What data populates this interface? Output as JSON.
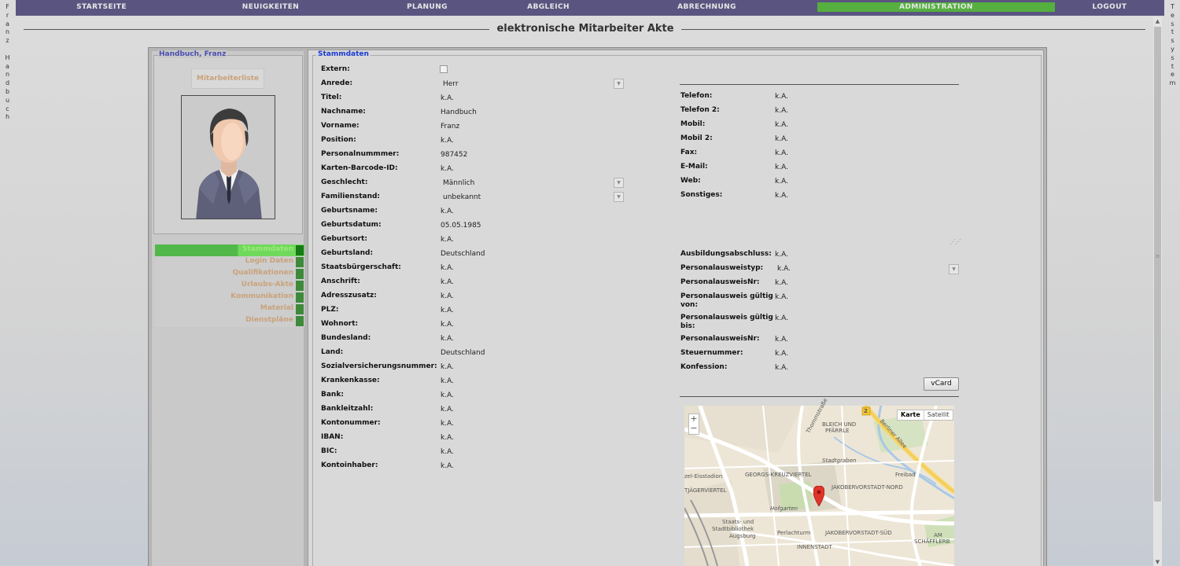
{
  "side_left": {
    "letters": [
      "F",
      "r",
      "a",
      "n",
      "z",
      "",
      "H",
      "a",
      "n",
      "d",
      "b",
      "u",
      "c",
      "h"
    ]
  },
  "side_right": {
    "letters": [
      "T",
      "e",
      "s",
      "t",
      "s",
      "y",
      "s",
      "t",
      "e",
      "m"
    ]
  },
  "nav": {
    "items": [
      {
        "label": "STARTSEITE"
      },
      {
        "label": "NEUIGKEITEN"
      },
      {
        "label": "PLANUNG"
      },
      {
        "label": "ABGLEICH"
      },
      {
        "label": "ABRECHNUNG"
      },
      {
        "label": "ADMINISTRATION"
      },
      {
        "label": "LOGOUT"
      }
    ],
    "active_index": 5
  },
  "window": {
    "title": "elektronische Mitarbeiter Akte"
  },
  "employee": {
    "legend": "Handbuch, Franz",
    "list_button": "Mitarbeiterliste"
  },
  "sidemenu": {
    "items": [
      {
        "label": "Stammdaten"
      },
      {
        "label": "Login Daten"
      },
      {
        "label": "Qualifikationen"
      },
      {
        "label": "Urlaubs-Akte"
      },
      {
        "label": "Kommunikation"
      },
      {
        "label": "Material"
      },
      {
        "label": "Dienstpläne"
      }
    ],
    "active_index": 0
  },
  "stammdaten": {
    "legend": "Stammdaten",
    "left_fields": [
      {
        "label": "Extern:",
        "value": ""
      },
      {
        "label": "Anrede:",
        "value": "Herr"
      },
      {
        "label": "Titel:",
        "value": "k.A."
      },
      {
        "label": "Nachname:",
        "value": "Handbuch"
      },
      {
        "label": "Vorname:",
        "value": "Franz"
      },
      {
        "label": "Position:",
        "value": "k.A."
      },
      {
        "label": "Personalnummmer:",
        "value": "987452"
      },
      {
        "label": "Karten-Barcode-ID:",
        "value": "k.A."
      },
      {
        "label": "Geschlecht:",
        "value": "Männlich"
      },
      {
        "label": "Familienstand:",
        "value": "unbekannt"
      },
      {
        "label": "Geburtsname:",
        "value": "k.A."
      },
      {
        "label": "Geburtsdatum:",
        "value": "05.05.1985"
      },
      {
        "label": "Geburtsort:",
        "value": "k.A."
      },
      {
        "label": "Geburtsland:",
        "value": "Deutschland"
      },
      {
        "label": "Staatsbürgerschaft:",
        "value": "k.A."
      },
      {
        "label": "Anschrift:",
        "value": "k.A."
      },
      {
        "label": "Adresszusatz:",
        "value": "k.A."
      },
      {
        "label": "PLZ:",
        "value": "k.A."
      },
      {
        "label": "Wohnort:",
        "value": "k.A."
      },
      {
        "label": "Bundesland:",
        "value": "k.A."
      },
      {
        "label": "Land:",
        "value": "Deutschland"
      },
      {
        "label": "Sozialversicherungsnummer:",
        "value": "k.A."
      },
      {
        "label": "Krankenkasse:",
        "value": "k.A."
      },
      {
        "label": "Bank:",
        "value": "k.A."
      },
      {
        "label": "Bankleitzahl:",
        "value": "k.A."
      },
      {
        "label": "Kontonummer:",
        "value": "k.A."
      },
      {
        "label": "IBAN:",
        "value": "k.A."
      },
      {
        "label": "BIC:",
        "value": "k.A."
      },
      {
        "label": "Kontoinhaber:",
        "value": "k.A."
      }
    ],
    "contact_fields": [
      {
        "label": "Telefon:",
        "value": "k.A."
      },
      {
        "label": "Telefon 2:",
        "value": "k.A."
      },
      {
        "label": "Mobil:",
        "value": "k.A."
      },
      {
        "label": "Mobil 2:",
        "value": "k.A."
      },
      {
        "label": "Fax:",
        "value": "k.A."
      },
      {
        "label": "E-Mail:",
        "value": "k.A."
      },
      {
        "label": "Web:",
        "value": "k.A."
      },
      {
        "label": "Sonstiges:",
        "value": "k.A."
      }
    ],
    "id_fields": [
      {
        "label": "Ausbildungsabschluss:",
        "value": "k.A."
      },
      {
        "label": "Personalausweistyp:",
        "value": "k.A."
      },
      {
        "label": "PersonalausweisNr:",
        "value": "k.A."
      },
      {
        "label": "Personalausweis gültig von:",
        "label1": "Personalausweis gültig",
        "label2": "von:",
        "value": "k.A."
      },
      {
        "label": "Personalausweis gültig bis:",
        "label1": "Personalausweis gültig",
        "label2": "bis:",
        "value": "k.A."
      },
      {
        "label": "PersonalausweisNr:",
        "value": "k.A."
      },
      {
        "label": "Steuernummer:",
        "value": "k.A."
      },
      {
        "label": "Konfession:",
        "value": "k.A."
      }
    ],
    "vcard_button": "vCard"
  },
  "map": {
    "type_map": "Karte",
    "type_satellite": "Satellit",
    "zoom_in": "+",
    "zoom_out": "−",
    "labels": [
      "Thommstraße",
      "BLEICH UND",
      "PFÄRRLE",
      "Stadtgraben",
      "zel-Eisstadion",
      "GEORGS-KREUZVIERTEL",
      "Freibad",
      "TJÄGERVIERTEL",
      "JAKOBERVORSTADT-NORD",
      "Hofgarten",
      "Staats- und",
      "Stadtbibliothek",
      "Augsburg",
      "Perlachturm",
      "JAKOBERVORSTADT-SÜD",
      "INNENSTADT",
      "AM",
      "SCHÄFFLERB",
      "Berliner Allee",
      "2"
    ]
  }
}
